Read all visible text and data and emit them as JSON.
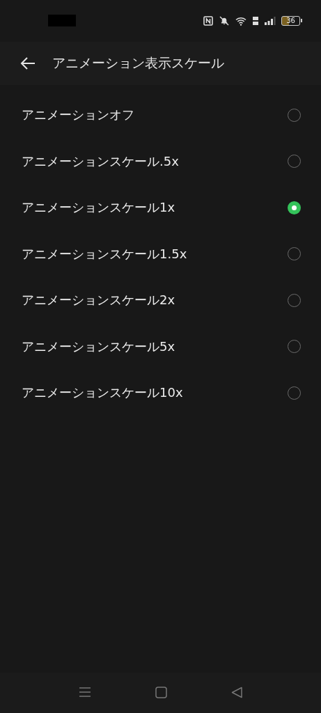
{
  "status_bar": {
    "battery": "36"
  },
  "header": {
    "title": "アニメーション表示スケール"
  },
  "options": [
    {
      "label": "アニメーションオフ",
      "selected": false
    },
    {
      "label": "アニメーションスケール.5x",
      "selected": false
    },
    {
      "label": "アニメーションスケール1x",
      "selected": true
    },
    {
      "label": "アニメーションスケール1.5x",
      "selected": false
    },
    {
      "label": "アニメーションスケール2x",
      "selected": false
    },
    {
      "label": "アニメーションスケール5x",
      "selected": false
    },
    {
      "label": "アニメーションスケール10x",
      "selected": false
    }
  ]
}
